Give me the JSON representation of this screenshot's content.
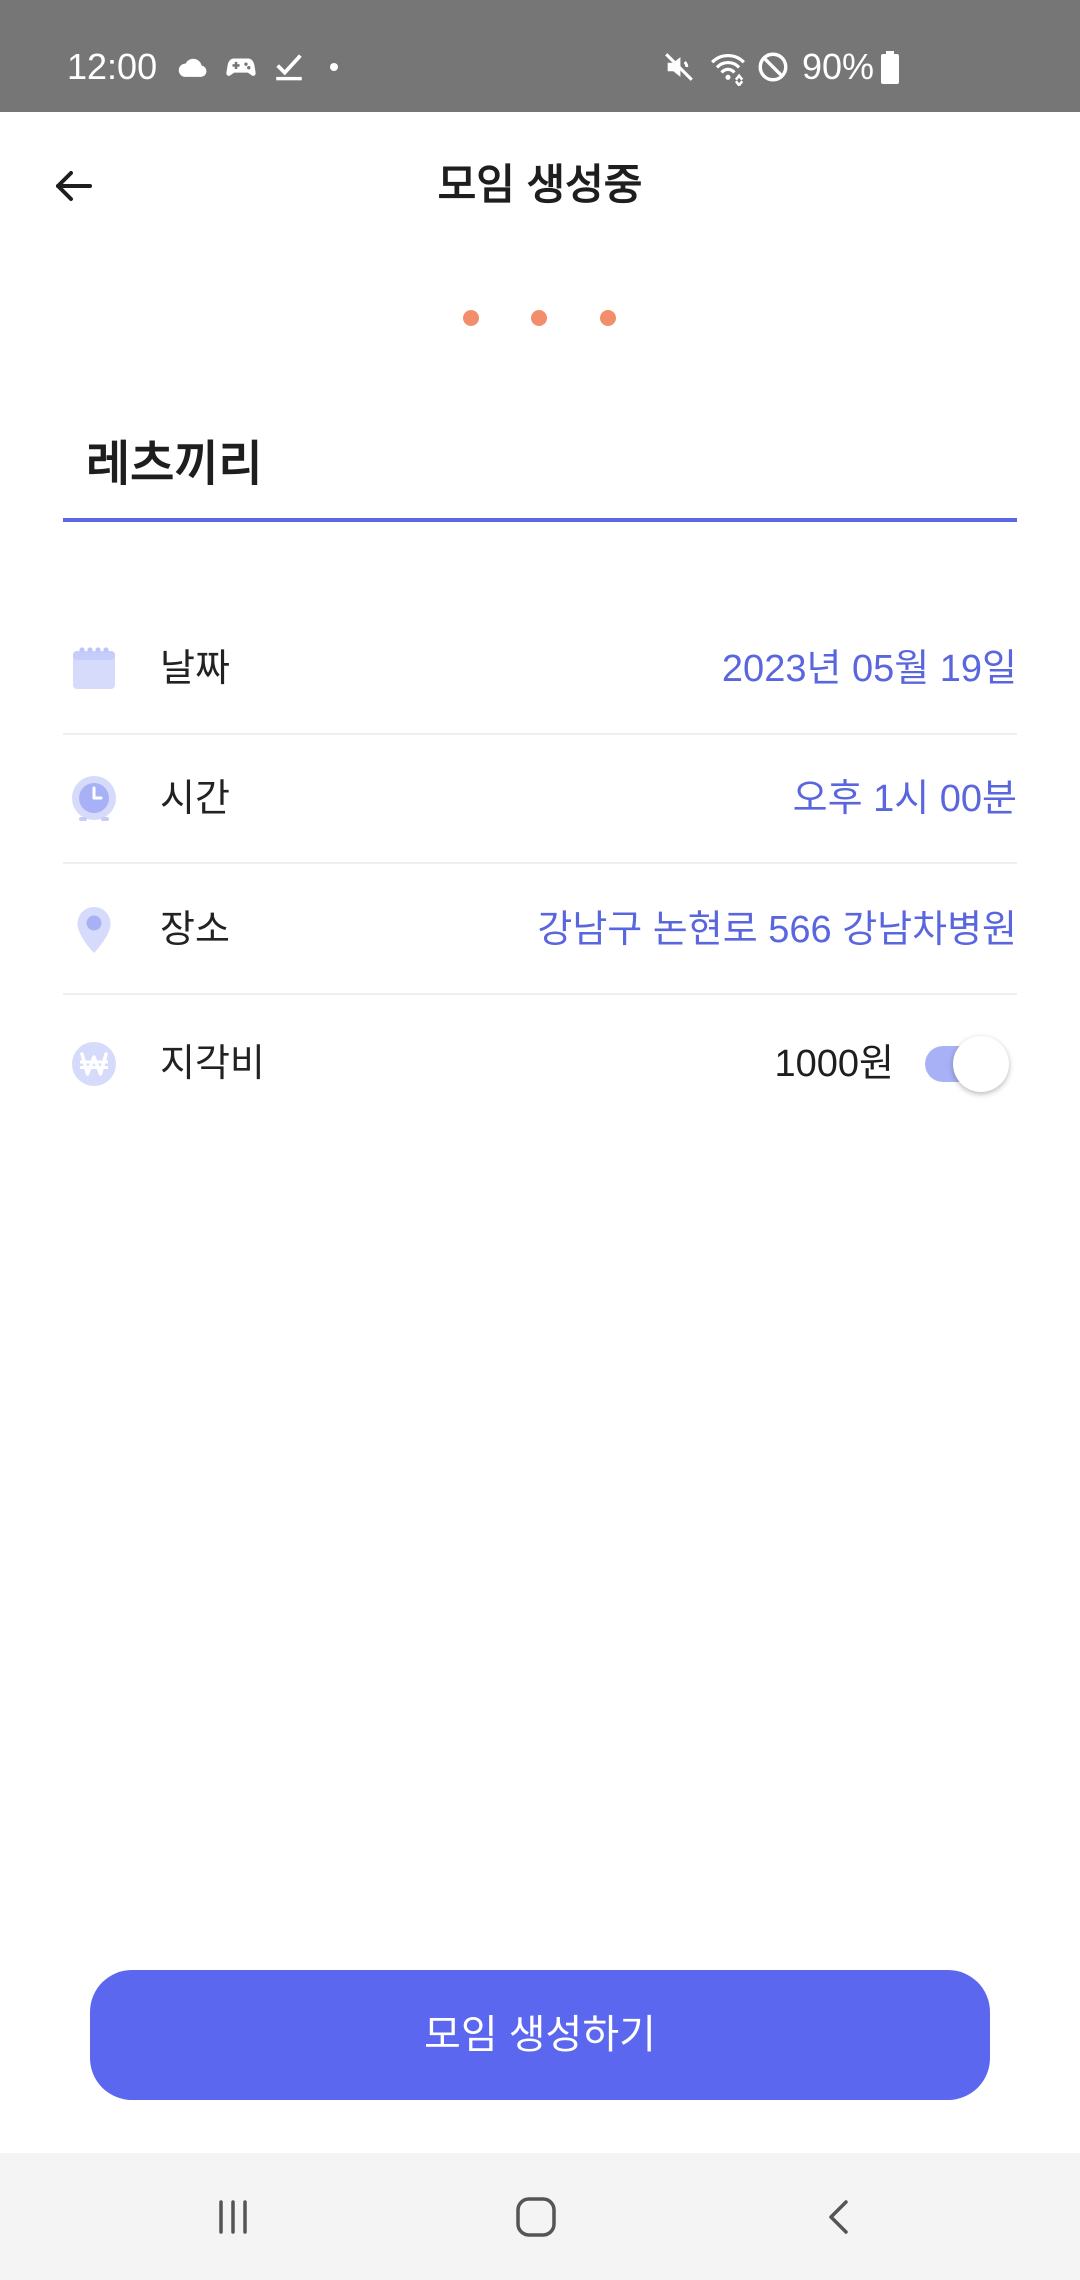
{
  "status_bar": {
    "time": "12:00",
    "battery": "90%",
    "left_icons": [
      "cloud-icon",
      "game-controller-icon",
      "task-check-icon",
      "notification-dot-icon"
    ],
    "right_icons": [
      "mute-icon",
      "wifi-icon",
      "do-not-disturb-icon",
      "battery-icon"
    ]
  },
  "header": {
    "back_icon": "arrow-left-icon",
    "title": "모임 생성중"
  },
  "step_dots": {
    "count": 3
  },
  "meeting_name": {
    "value": "레츠끼리"
  },
  "details": [
    {
      "icon": "calendar-icon",
      "label": "날짜",
      "value": "2023년 05월 19일"
    },
    {
      "icon": "clock-icon",
      "label": "시간",
      "value": "오후 1시 00분"
    },
    {
      "icon": "location-pin-icon",
      "label": "장소",
      "value": "강남구 논현로 566 강남차병원"
    }
  ],
  "late_fee": {
    "icon": "won-icon",
    "label": "지각비",
    "value": "1000원",
    "enabled": true
  },
  "submit_button": {
    "label": "모임 생성하기"
  },
  "nav_bar": {
    "icons": [
      "recent-apps-icon",
      "home-icon",
      "back-icon"
    ]
  },
  "colors": {
    "status_bar_bg": "#767676",
    "accent": "#5B67EE",
    "accent_line": "#5B67E0",
    "value_text": "#5A66DE",
    "dot": "#F28E6C",
    "toggle_track": "#A9B1F6",
    "icon_tint": "#D6DBFB"
  }
}
